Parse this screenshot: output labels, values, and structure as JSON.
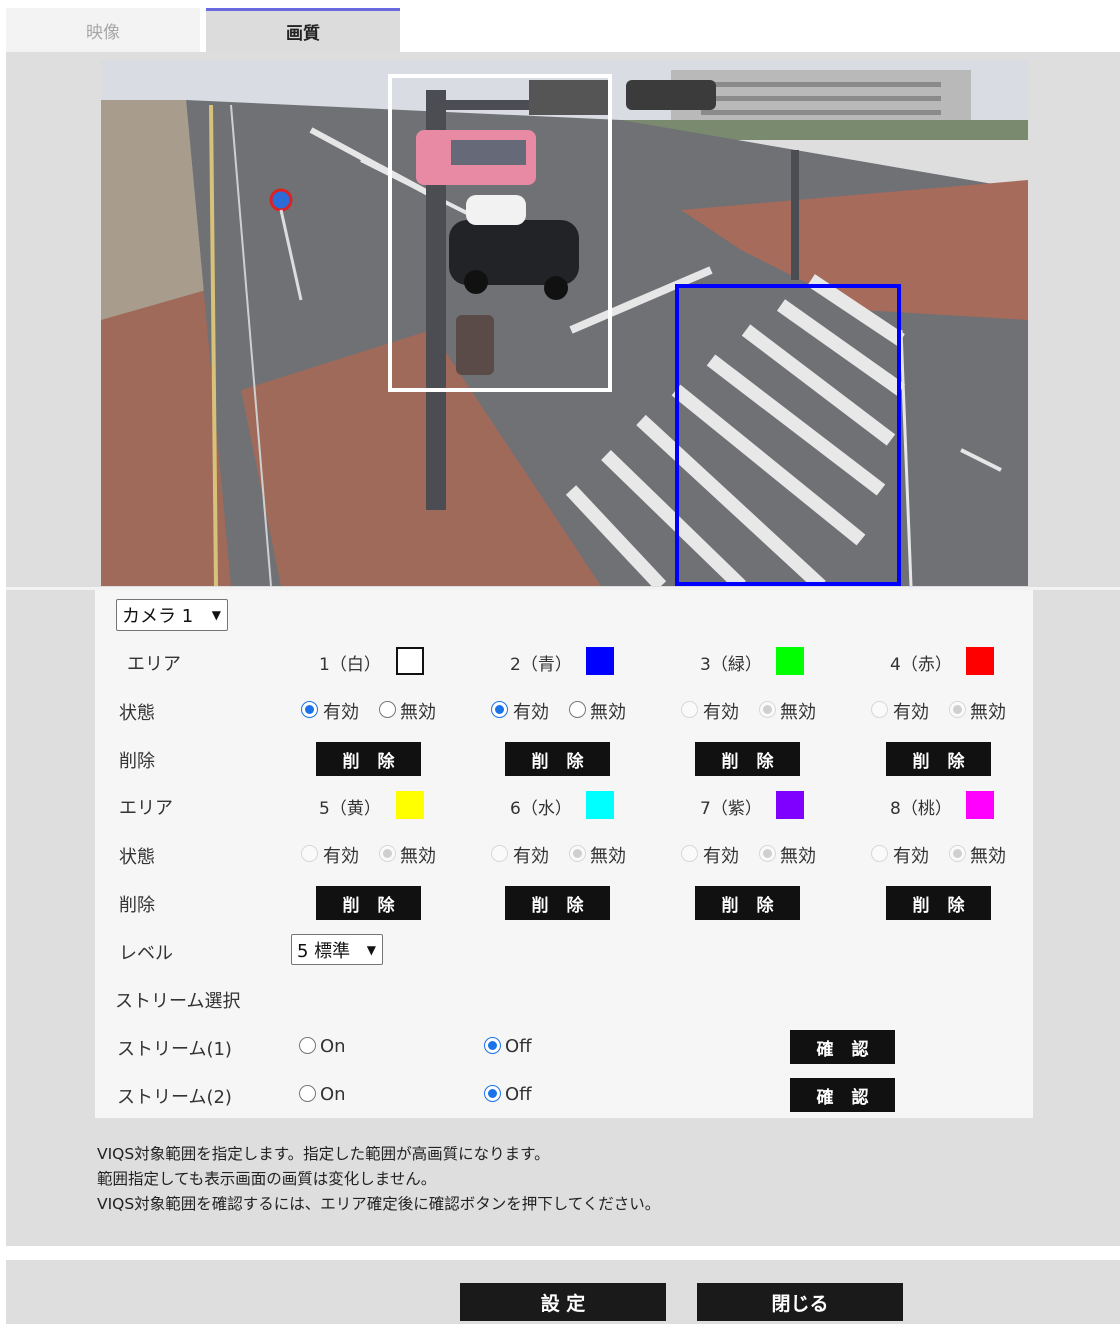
{
  "tabs": [
    {
      "label": "映像",
      "active": false
    },
    {
      "label": "画質",
      "active": true
    }
  ],
  "camera_select": {
    "value": "カメラ 1"
  },
  "row_labels": {
    "area": "エリア",
    "status": "状態",
    "delete": "削除",
    "area2": "エリア",
    "status2": "状態",
    "delete2": "削除",
    "level": "レベル",
    "stream_select": "ストリーム選択",
    "stream1": "ストリーム(1)",
    "stream2": "ストリーム(2)"
  },
  "areas": [
    {
      "label": "1（白）",
      "color": "#ffffff",
      "status": "有効",
      "enabled": true
    },
    {
      "label": "2（青）",
      "color": "#0000ff",
      "status": "有効",
      "enabled": true
    },
    {
      "label": "3（緑）",
      "color": "#00ff00",
      "status": "無効",
      "enabled": false
    },
    {
      "label": "4（赤）",
      "color": "#ff0000",
      "status": "無効",
      "enabled": false
    },
    {
      "label": "5（黄）",
      "color": "#ffff00",
      "status": "無効",
      "enabled": false
    },
    {
      "label": "6（水）",
      "color": "#00ffff",
      "status": "無効",
      "enabled": false
    },
    {
      "label": "7（紫）",
      "color": "#8000ff",
      "status": "無効",
      "enabled": false
    },
    {
      "label": "8（桃）",
      "color": "#ff00ff",
      "status": "無効",
      "enabled": false
    }
  ],
  "status_options": {
    "on": "有効",
    "off": "無効"
  },
  "delete_button": "削除",
  "level_select": {
    "value": "5 標準"
  },
  "streams": [
    {
      "on_label": "On",
      "off_label": "Off",
      "selected": "Off",
      "confirm_label": "確認"
    },
    {
      "on_label": "On",
      "off_label": "Off",
      "selected": "Off",
      "confirm_label": "確認"
    }
  ],
  "notes": [
    "VIQS対象範囲を指定します。指定した範囲が高画質になります。",
    "範囲指定しても表示画面の画質は変化しません。",
    "VIQS対象範囲を確認するには、エリア確定後に確認ボタンを押下してください。"
  ],
  "footer": {
    "set_label": "設 定",
    "close_label": "閉じる"
  },
  "overlay_colors": {
    "area1": "#ffffff",
    "area2": "#0000ff"
  }
}
